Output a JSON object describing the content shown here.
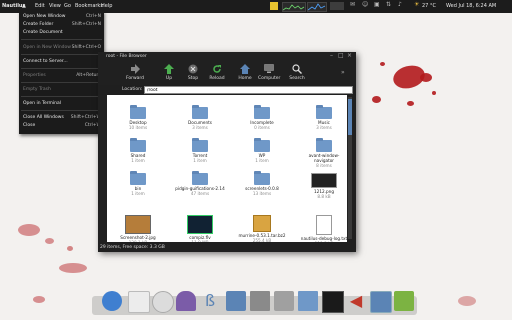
{
  "topbar": {
    "app_name": "Nautilus",
    "menus": [
      "Edit",
      "View",
      "Go",
      "Bookmarks",
      "Help"
    ],
    "weather": "27 °C",
    "clock": "Wed Jul 18, 6:24 AM"
  },
  "app_menu": {
    "items": [
      {
        "label": "Open New Window",
        "accel": "Ctrl+N",
        "enabled": true
      },
      {
        "label": "Create Folder",
        "accel": "Shift+Ctrl+N",
        "enabled": true
      },
      {
        "label": "Create Document",
        "accel": "",
        "enabled": true
      },
      {
        "label": "Open in New Window",
        "accel": "Shift+Ctrl+O",
        "enabled": false
      },
      {
        "label": "Connect to Server...",
        "accel": "",
        "enabled": true
      },
      {
        "label": "Properties",
        "accel": "Alt+Return",
        "enabled": false
      },
      {
        "label": "Empty Trash",
        "accel": "",
        "enabled": false
      },
      {
        "label": "Open in Terminal",
        "accel": "",
        "enabled": true
      },
      {
        "label": "Close All Windows",
        "accel": "Shift+Ctrl+W",
        "enabled": true
      },
      {
        "label": "Close",
        "accel": "Ctrl+W",
        "enabled": true
      }
    ]
  },
  "window": {
    "title": "root - File Browser",
    "toolbar": [
      "Forward",
      "Up",
      "Stop",
      "Reload",
      "Home",
      "Computer",
      "Search"
    ],
    "location_label": "Location:",
    "location_value": "/root",
    "status": "29 items, Free space: 3.3 GB"
  },
  "files": [
    {
      "name": "Desktop",
      "sub": "10 items",
      "type": "folder"
    },
    {
      "name": "Documents",
      "sub": "3 items",
      "type": "folder"
    },
    {
      "name": "Incomplete",
      "sub": "0 items",
      "type": "folder"
    },
    {
      "name": "Music",
      "sub": "3 items",
      "type": "folder"
    },
    {
      "name": "Shared",
      "sub": "1 item",
      "type": "folder"
    },
    {
      "name": "Torrent",
      "sub": "1 item",
      "type": "folder"
    },
    {
      "name": "WP",
      "sub": "1 item",
      "type": "folder"
    },
    {
      "name": "avant-window-navigator",
      "sub": "8 items",
      "type": "folder"
    },
    {
      "name": "bin",
      "sub": "1 item",
      "type": "folder"
    },
    {
      "name": "pidgin-guifications-2.14",
      "sub": "47 items",
      "type": "folder"
    },
    {
      "name": "screenlets-0.0.8",
      "sub": "13 items",
      "type": "folder"
    },
    {
      "name": "1212.png",
      "sub": "8.8 kB",
      "type": "image"
    },
    {
      "name": "Screenshot-2.jpg",
      "sub": "128.1 kB",
      "type": "photo"
    },
    {
      "name": "compiz.flv",
      "sub": "11.0 MB",
      "type": "video"
    },
    {
      "name": "murrine-0.53.1.tar.bz2",
      "sub": "255.4 kB",
      "type": "archive"
    },
    {
      "name": "nautilus-debug-log.txt",
      "sub": "119.8 kB",
      "type": "text"
    }
  ],
  "colors": {
    "panel": "#1c1c1c",
    "window": "#202020",
    "folder": "#6f98c8",
    "blood": "#b3191c",
    "dock_active": "#5b84b5"
  }
}
